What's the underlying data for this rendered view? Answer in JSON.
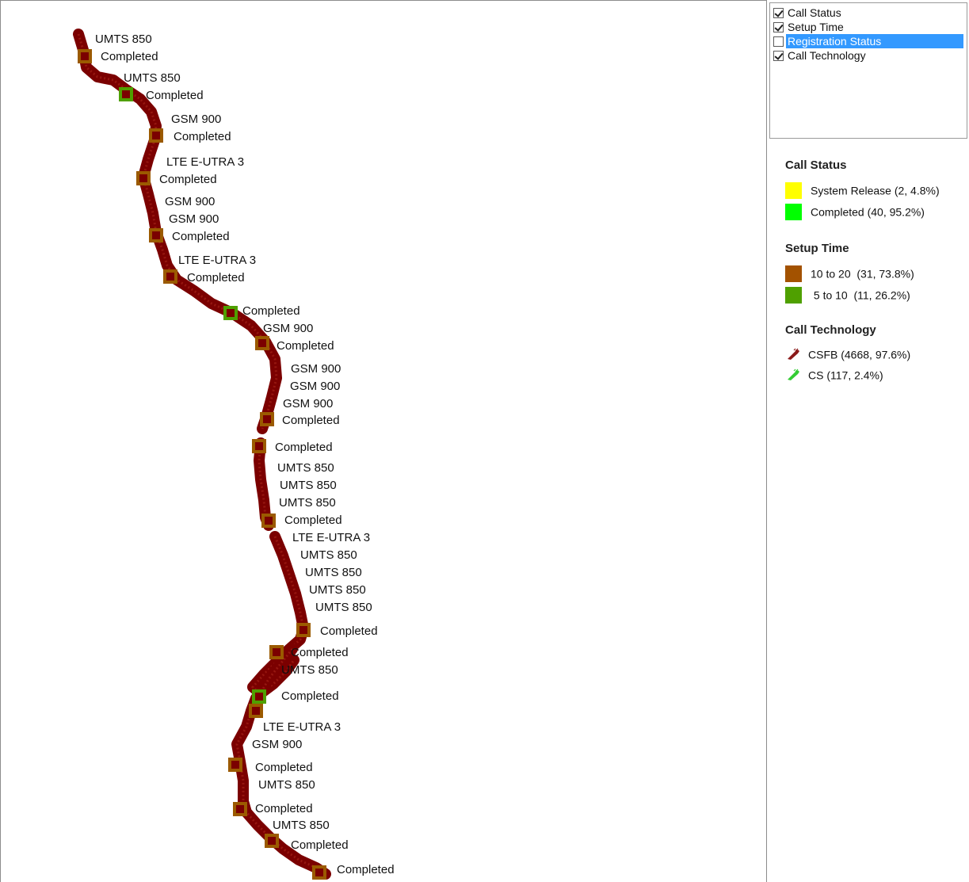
{
  "map": {
    "labels": [
      "UMTS 850",
      "Completed",
      "UMTS 850",
      "Completed",
      "GSM 900",
      "Completed",
      "LTE E-UTRA 3",
      "Completed",
      "GSM 900",
      "GSM 900",
      "Completed",
      "LTE E-UTRA 3",
      "Completed",
      "Completed",
      "GSM 900",
      "Completed",
      "GSM 900",
      "GSM 900",
      "GSM 900",
      "Completed",
      "Completed",
      "UMTS 850",
      "UMTS 850",
      "UMTS 850",
      "Completed",
      "LTE E-UTRA 3",
      "UMTS 850",
      "UMTS 850",
      "UMTS 850",
      "UMTS 850",
      "Completed",
      "Completed",
      "UMTS 850",
      "Completed",
      "LTE E-UTRA 3",
      "GSM 900",
      "Completed",
      "UMTS 850",
      "Completed",
      "UMTS 850",
      "Completed",
      "Completed"
    ],
    "route_color": "#7b0000",
    "marker_color": "#9b5a00",
    "marker_green": "#4fa000"
  },
  "layers": {
    "items": [
      {
        "label": "Call Status",
        "checked": true,
        "selected": false
      },
      {
        "label": "Setup Time",
        "checked": true,
        "selected": false
      },
      {
        "label": "Registration Status",
        "checked": false,
        "selected": true
      },
      {
        "label": "Call Technology",
        "checked": true,
        "selected": false
      }
    ]
  },
  "legend": {
    "call_status": {
      "title": "Call Status",
      "items": [
        {
          "label": "System Release  (2, 4.8%)",
          "color": "#ffff00"
        },
        {
          "label": "Completed  (40, 95.2%)",
          "color": "#00ff00"
        }
      ]
    },
    "setup_time": {
      "title": "Setup Time",
      "items": [
        {
          "label": "10 to 20  (31, 73.8%)",
          "color": "#a35200"
        },
        {
          "label": " 5 to 10  (11, 26.2%)",
          "color": "#4fa000"
        }
      ]
    },
    "call_technology": {
      "title": "Call Technology",
      "items": [
        {
          "label": "CSFB  (4668, 97.6%)",
          "icon": "phone-icon",
          "color": "#8b1a1a"
        },
        {
          "label": "CS  (117, 2.4%)",
          "icon": "phone-icon",
          "color": "#33cc33"
        }
      ]
    }
  }
}
